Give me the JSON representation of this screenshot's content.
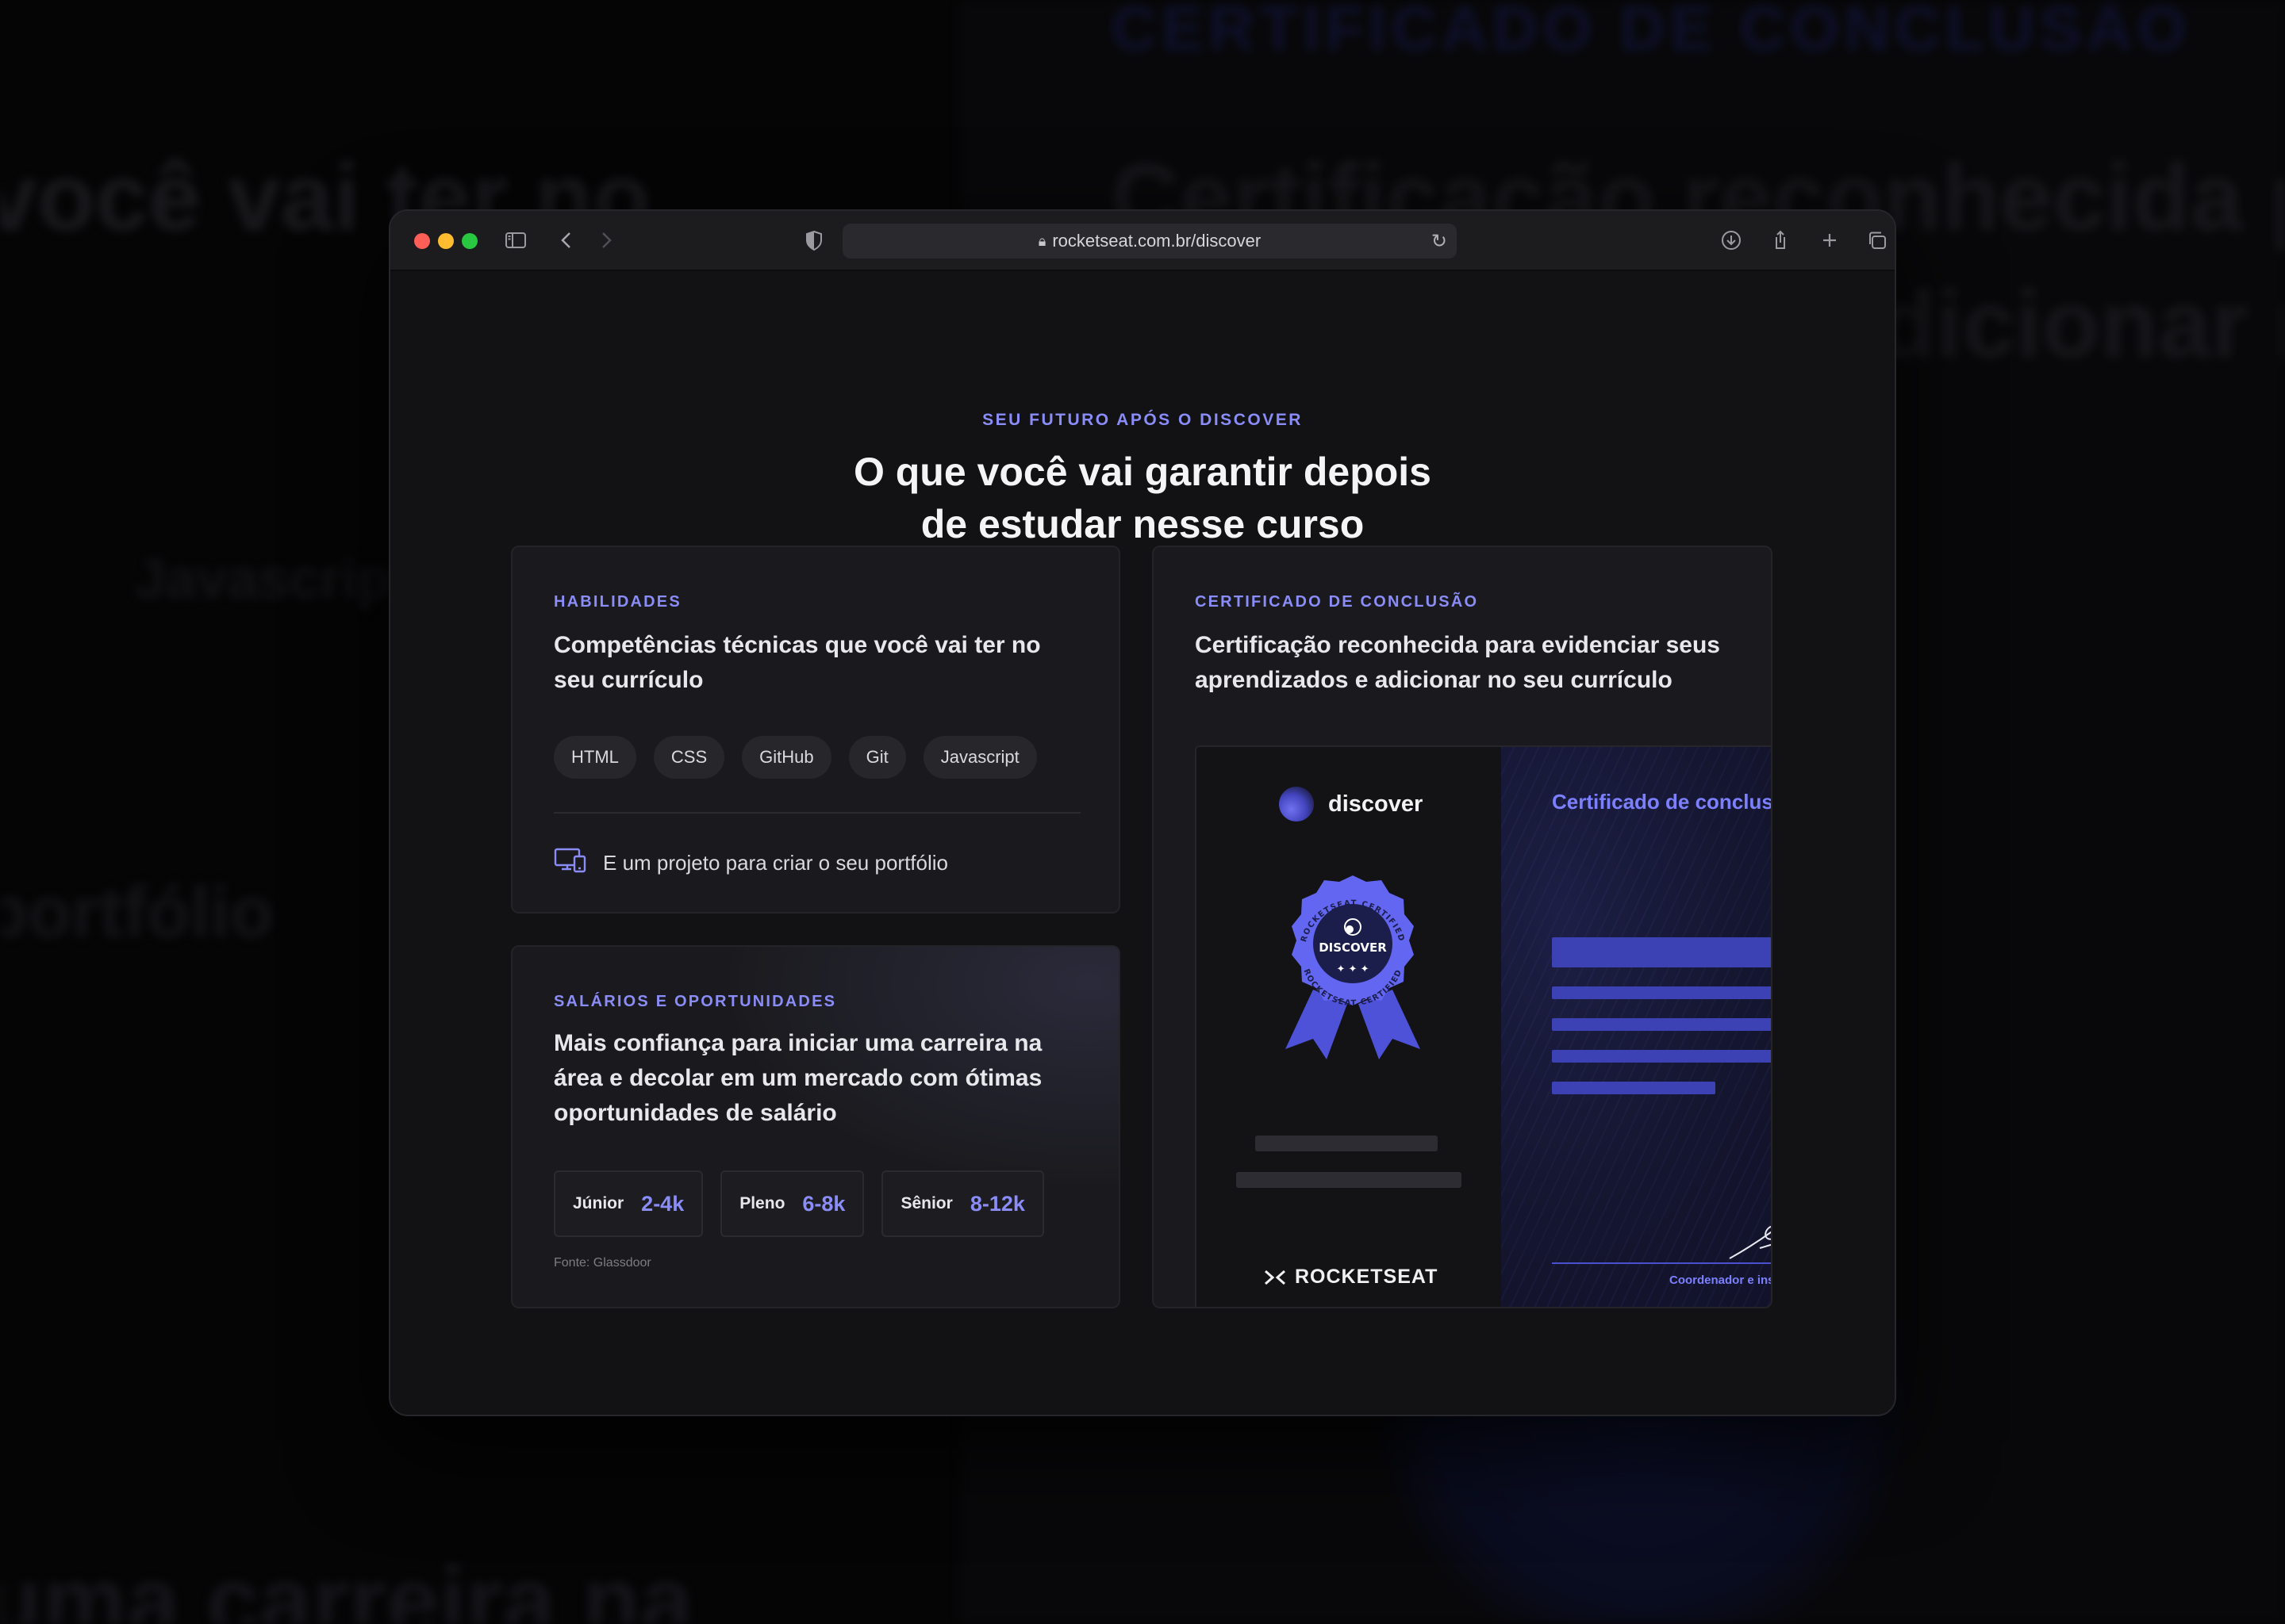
{
  "browser": {
    "url": "rocketseat.com.br/discover"
  },
  "section": {
    "eyebrow": "SEU FUTURO APÓS O DISCOVER",
    "title_line1": "O que você vai garantir depois",
    "title_line2": "de estudar nesse curso"
  },
  "skills": {
    "eyebrow": "HABILIDADES",
    "text": "Competências técnicas que você vai ter no seu currículo",
    "chips": [
      "HTML",
      "CSS",
      "GitHub",
      "Git",
      "Javascript"
    ],
    "portfolio": "E um projeto para criar o seu portfólio"
  },
  "salaries": {
    "eyebrow": "SALÁRIOS E OPORTUNIDADES",
    "text": "Mais confiança para iniciar uma carreira na área e decolar em um mercado com ótimas oportunidades de salário",
    "items": [
      {
        "level": "Júnior",
        "range": "2-4k"
      },
      {
        "level": "Pleno",
        "range": "6-8k"
      },
      {
        "level": "Sênior",
        "range": "8-12k"
      }
    ],
    "source": "Fonte: Glassdoor"
  },
  "certificate": {
    "eyebrow": "CERTIFICADO DE CONCLUSÃO",
    "text": "Certificação reconhecida para evidenciar seus aprendizados e adicionar no seu currículo",
    "brand": "discover",
    "badge_label": "DISCOVER",
    "badge_ring": "ROCKETSEAT CERTIFIED",
    "company": "ROCKETSEAT",
    "cert_title": "Certificado de conclusão",
    "signature_caption": "Coordenador e instrutor"
  },
  "background": {
    "text1": "você vai ter no",
    "text2": "Certificação reconhecida para",
    "text3": "adicionar no seu",
    "text4": "Javascript",
    "text5": "portfólio",
    "text6": "uma carreira na",
    "text7": "CERTIFICADO DE CONCLUSÃO"
  },
  "colors": {
    "accent": "#8a8cf8",
    "cert_blue": "#3c41b4",
    "surface": "#1a1a1e",
    "page": "#121214"
  }
}
